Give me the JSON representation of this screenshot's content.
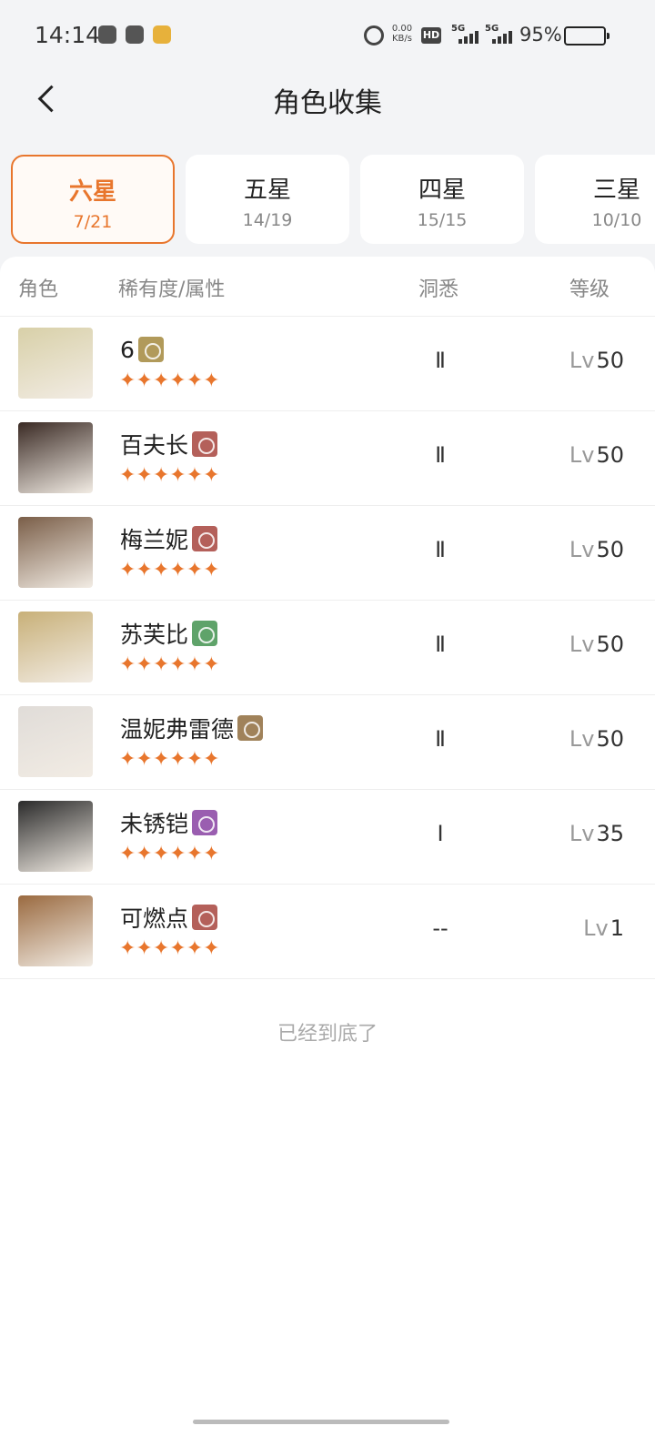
{
  "status_bar": {
    "time": "14:14",
    "net_speed_value": "0.00",
    "net_speed_unit": "KB/s",
    "hd_label": "HD",
    "signal1_label": "5G",
    "signal2_label": "5G",
    "battery_percent": "95%",
    "battery_level": 0.95,
    "battery_color": "#f5b400"
  },
  "header": {
    "title": "角色收集",
    "back_icon": "chevron-left-icon"
  },
  "tabs": [
    {
      "label": "六星",
      "count": "7/21",
      "active": true
    },
    {
      "label": "五星",
      "count": "14/19",
      "active": false
    },
    {
      "label": "四星",
      "count": "15/15",
      "active": false
    },
    {
      "label": "三星",
      "count": "10/10",
      "active": false
    }
  ],
  "columns": {
    "role": "角色",
    "rarity": "稀有度/属性",
    "insight": "洞悉",
    "level": "等级"
  },
  "level_prefix": "Lv",
  "accent_color": "#e8762d",
  "characters": [
    {
      "name": "6",
      "attr_color": "#b19a5a",
      "attr_icon": "triangle-eye-icon",
      "stars": "✦✦✦✦✦✦",
      "insight": "Ⅱ",
      "level": "50",
      "avatar_color": "#d8d0a8"
    },
    {
      "name": "百夫长",
      "attr_color": "#b4605a",
      "attr_icon": "claw-icon",
      "stars": "✦✦✦✦✦✦",
      "insight": "Ⅱ",
      "level": "50",
      "avatar_color": "#3a2a24"
    },
    {
      "name": "梅兰妮",
      "attr_color": "#b4605a",
      "attr_icon": "claw-icon",
      "stars": "✦✦✦✦✦✦",
      "insight": "Ⅱ",
      "level": "50",
      "avatar_color": "#7a5e48"
    },
    {
      "name": "苏芙比",
      "attr_color": "#5fa36a",
      "attr_icon": "leaf-icon",
      "stars": "✦✦✦✦✦✦",
      "insight": "Ⅱ",
      "level": "50",
      "avatar_color": "#c8b078"
    },
    {
      "name": "温妮弗雷德",
      "attr_color": "#a0825a",
      "attr_icon": "flask-icon",
      "stars": "✦✦✦✦✦✦",
      "insight": "Ⅱ",
      "level": "50",
      "avatar_color": "#e0dcd8"
    },
    {
      "name": "未锈铠",
      "attr_color": "#9a5eb0",
      "attr_icon": "spiral-icon",
      "stars": "✦✦✦✦✦✦",
      "insight": "Ⅰ",
      "level": "35",
      "avatar_color": "#2a2a2a"
    },
    {
      "name": "可燃点",
      "attr_color": "#b4605a",
      "attr_icon": "claw-icon",
      "stars": "✦✦✦✦✦✦",
      "insight": "--",
      "level": "1",
      "avatar_color": "#9a6a40"
    }
  ],
  "end_text": "已经到底了"
}
